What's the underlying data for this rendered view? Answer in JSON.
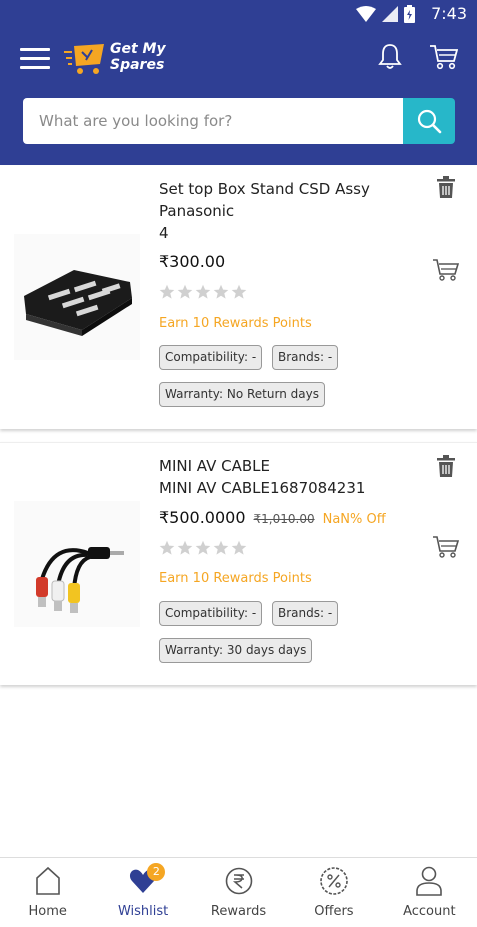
{
  "status_bar": {
    "time": "7:43"
  },
  "header": {
    "logo_text_line1": "Get My",
    "logo_text_line2": "Spares",
    "search_placeholder": "What are you looking for?"
  },
  "wishlist": [
    {
      "title_line1": "Set top Box Stand CSD Assy",
      "title_line2": "Panasonic",
      "title_line3": "4",
      "price": "₹300.00",
      "rating": 0,
      "rewards": "Earn 10 Rewards Points",
      "compatibility": "Compatibility: -",
      "brands": "Brands: -",
      "warranty": "Warranty: No Return days"
    },
    {
      "title_line1": "MINI AV CABLE",
      "title_line2": "MINI AV CABLE1687084231",
      "price": "₹500.0000",
      "old_price": "₹1,010.00",
      "discount": "NaN% Off",
      "rating": 0,
      "rewards": "Earn 10 Rewards Points",
      "compatibility": "Compatibility: -",
      "brands": "Brands: -",
      "warranty": "Warranty: 30 days days"
    }
  ],
  "bottom_nav": [
    {
      "label": "Home",
      "icon": "home-icon"
    },
    {
      "label": "Wishlist",
      "icon": "heart-icon",
      "badge": "2",
      "active": true
    },
    {
      "label": "Rewards",
      "icon": "rupee-icon"
    },
    {
      "label": "Offers",
      "icon": "percent-icon"
    },
    {
      "label": "Account",
      "icon": "user-icon"
    }
  ],
  "colors": {
    "primary": "#2f3f94",
    "accent": "#f5a623",
    "search_button": "#27b7c9"
  }
}
